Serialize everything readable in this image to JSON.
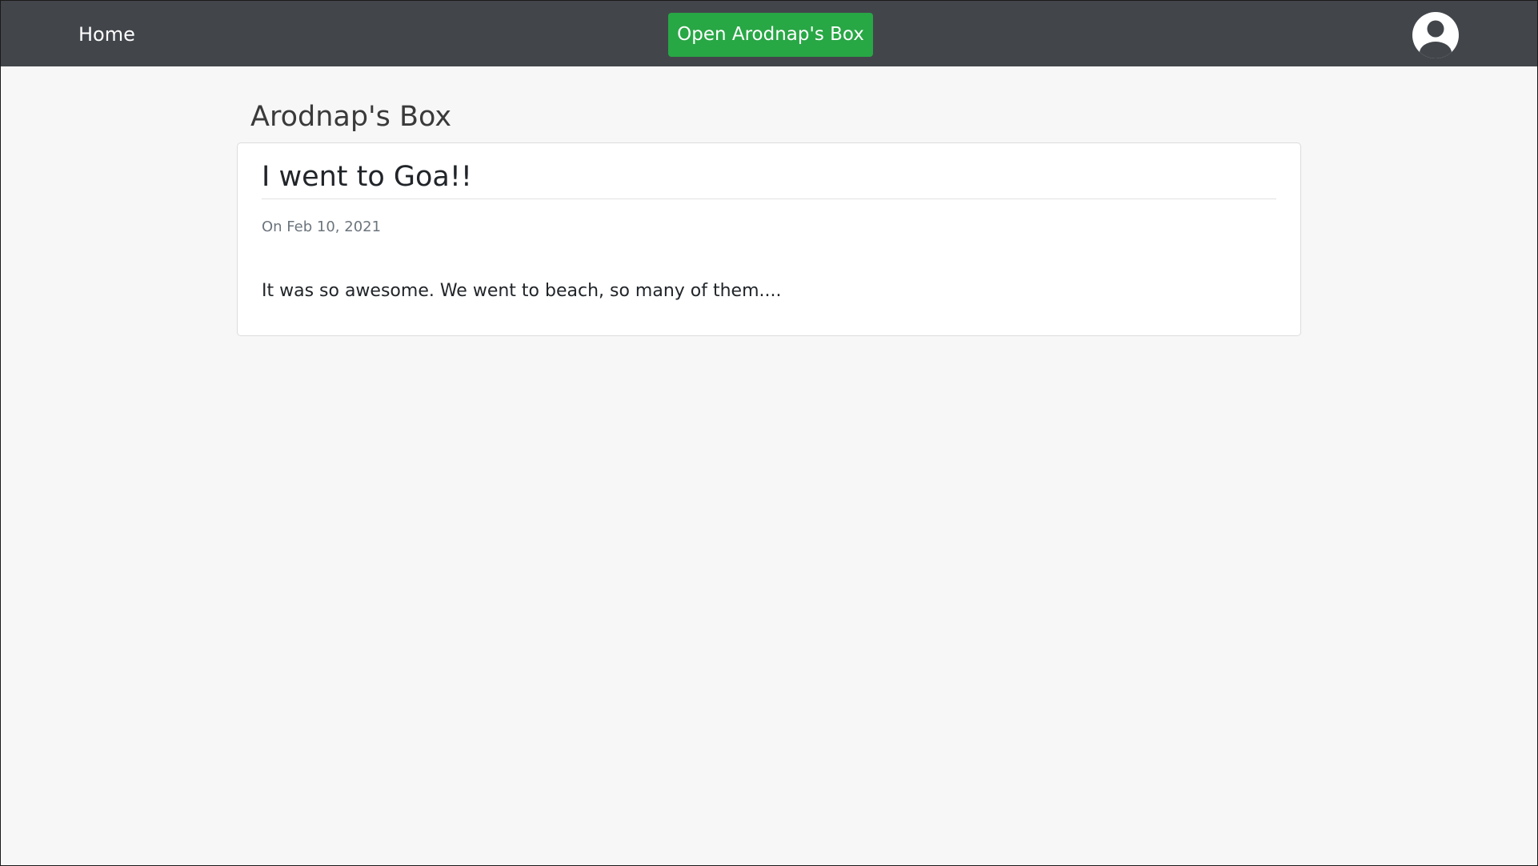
{
  "navbar": {
    "home_label": "Home",
    "open_box_label": "Open Arodnap's Box",
    "avatar_icon": "user-circle-icon",
    "bg_color": "#42464b",
    "button_color": "#28a745"
  },
  "page": {
    "title": "Arodnap's Box"
  },
  "post": {
    "title": "I went to Goa!!",
    "date": "On Feb 10, 2021",
    "body": "It was so awesome. We went to beach, so many of them...."
  }
}
